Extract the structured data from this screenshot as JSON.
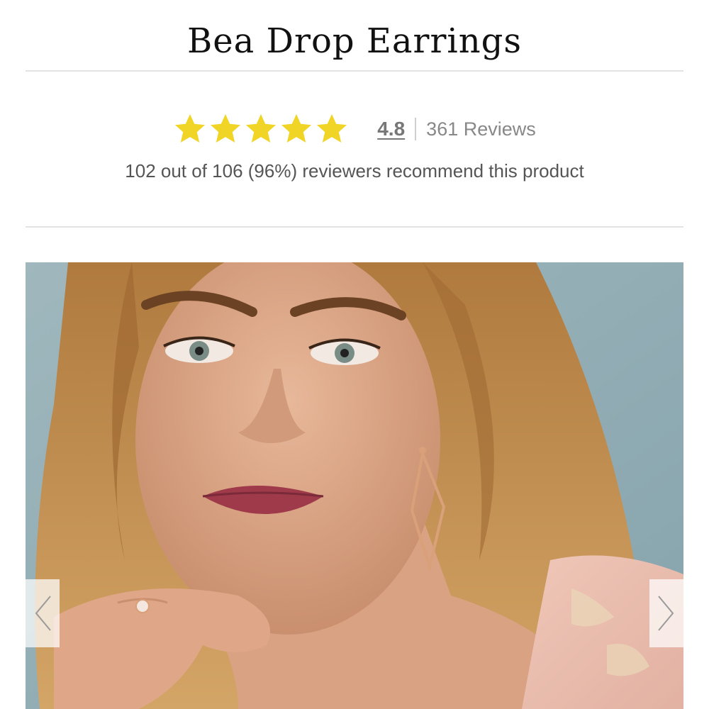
{
  "product": {
    "title": "Bea Drop Earrings"
  },
  "rating": {
    "value": "4.8",
    "stars": 5,
    "reviews_label": "361 Reviews",
    "recommend_text": "102 out of 106 (96%) reviewers recommend this product",
    "star_color": "#f0d426"
  },
  "gallery": {
    "image_icon": "product-photo",
    "prev_icon": "chevron-left-icon",
    "next_icon": "chevron-right-icon"
  }
}
